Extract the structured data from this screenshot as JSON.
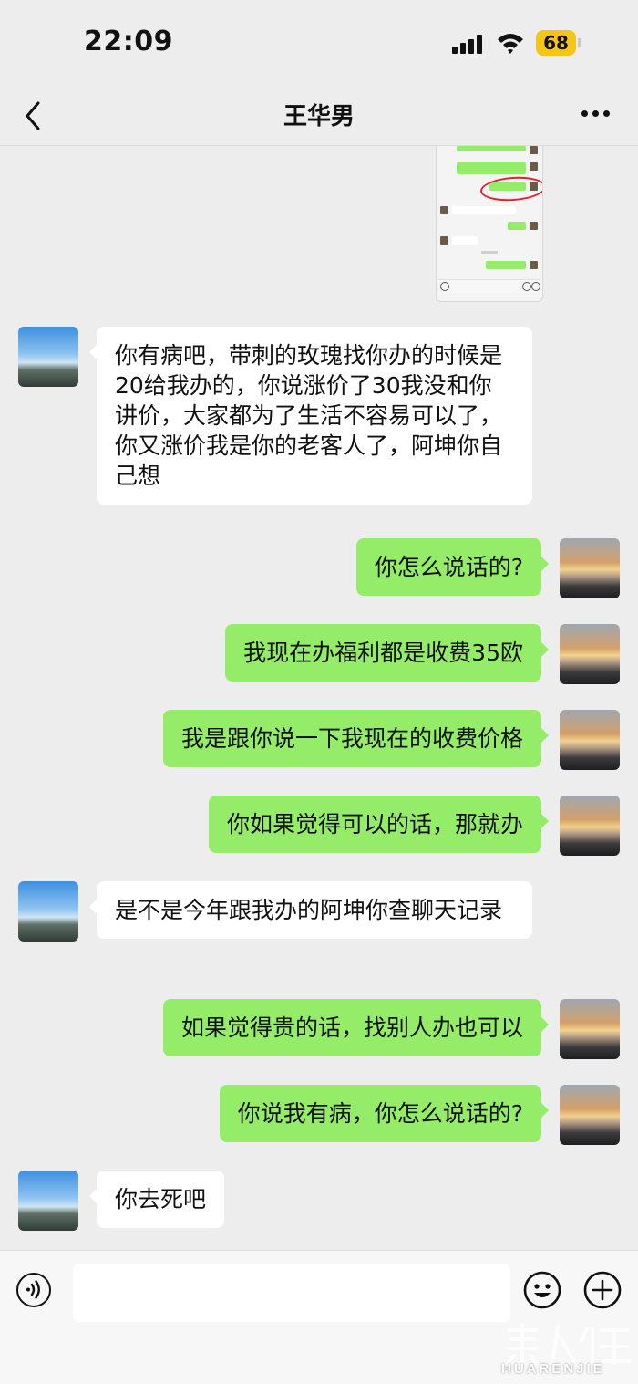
{
  "status_bar": {
    "time": "22:09",
    "battery": "68"
  },
  "header": {
    "title": "王华男"
  },
  "messages": [
    {
      "side": "in",
      "text": "你有病吧，带刺的玫瑰找你办的时候是20给我办的，你说涨价了30我没和你讲价，大家都为了生活不容易可以了，你又涨价我是你的老客人了，阿坤你自己想"
    },
    {
      "side": "out",
      "text": "你怎么说话的?"
    },
    {
      "side": "out",
      "text": "我现在办福利都是收费35欧"
    },
    {
      "side": "out",
      "text": "我是跟你说一下我现在的收费价格"
    },
    {
      "side": "out",
      "text": "你如果觉得可以的话，那就办"
    },
    {
      "side": "in",
      "text": "是不是今年跟我办的阿坤你查聊天记录"
    },
    {
      "side": "out",
      "text": "如果觉得贵的话，找别人办也可以"
    },
    {
      "side": "out",
      "text": "你说我有病，你怎么说话的?"
    },
    {
      "side": "in",
      "text": "你去死吧"
    }
  ],
  "watermark": {
    "chars": "華人街",
    "url": "HUARENJIE"
  },
  "colors": {
    "background": "#ededed",
    "outgoing_bubble": "#95ec69",
    "incoming_bubble": "#ffffff",
    "battery": "#f5c518",
    "highlight_circle": "#e0242a"
  },
  "icons": [
    "back-icon",
    "more-icon",
    "voice-icon",
    "emoji-icon",
    "plus-icon",
    "signal-icon",
    "wifi-icon"
  ]
}
